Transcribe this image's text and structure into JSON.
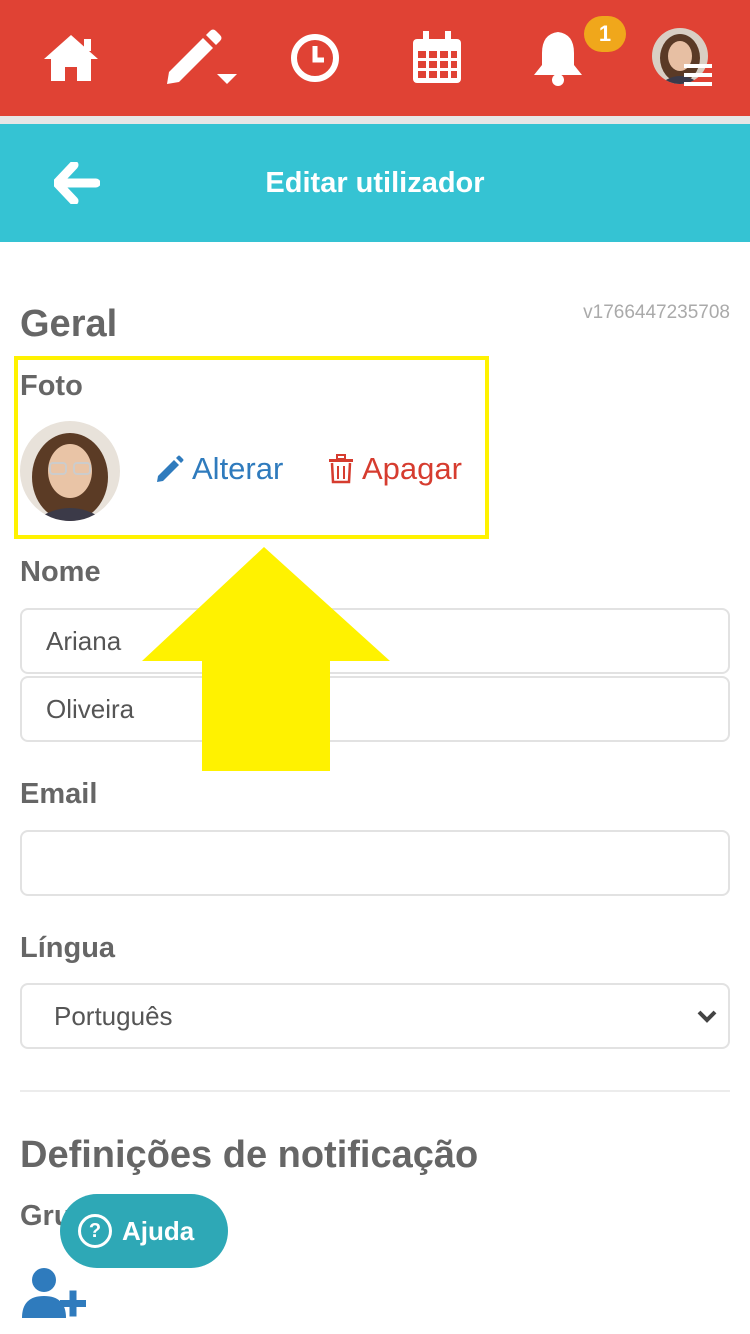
{
  "nav": {
    "items": [
      {
        "name": "home-icon"
      },
      {
        "name": "edit-icon"
      },
      {
        "name": "clock-icon"
      },
      {
        "name": "calendar-icon"
      },
      {
        "name": "bell-icon"
      }
    ],
    "notification_count": "1"
  },
  "header": {
    "title": "Editar utilizador"
  },
  "version": "v1766447235708",
  "general": {
    "title": "Geral",
    "photo_label": "Foto",
    "change_label": "Alterar",
    "delete_label": "Apagar",
    "name_label": "Nome",
    "first_name": "Ariana",
    "last_name": "Oliveira",
    "email_label": "Email",
    "email_value": "",
    "language_label": "Língua",
    "language_value": "Português"
  },
  "notifications": {
    "title": "Definições de notificação",
    "groups_label": "Gru"
  },
  "help": {
    "label": "Ajuda"
  },
  "colors": {
    "topbar": "#e04234",
    "header": "#35c3d3",
    "badge": "#f0a71b",
    "change": "#2f7bbd",
    "delete": "#d63c2f",
    "highlight": "#fff200",
    "help": "#2ea8b6"
  }
}
